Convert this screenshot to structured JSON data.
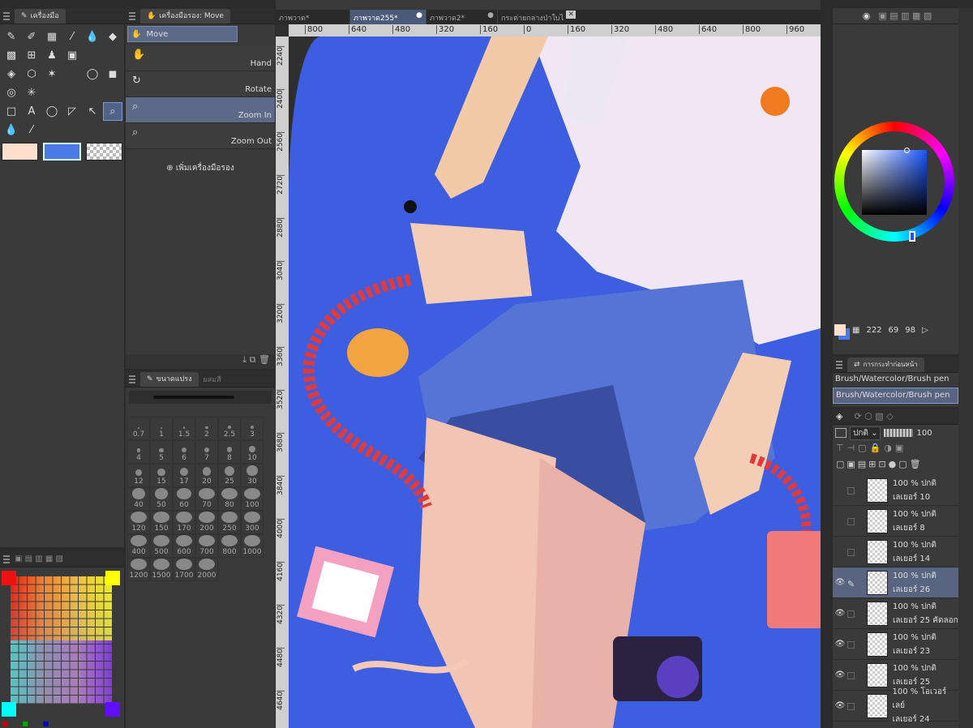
{
  "doc_tabs": [
    "ภาพวาด*",
    "ภาพวาด255*",
    "ภาพวาด2*",
    "กระต่ายกลางป่าใบไ"
  ],
  "tool_panel": {
    "title": "เครื่องมือ"
  },
  "subtool_panel": {
    "title": "เครื่องมือรอง: Move",
    "items": [
      {
        "label": "Move",
        "name": "move"
      },
      {
        "label": "Hand",
        "name": "hand"
      },
      {
        "label": "Rotate",
        "name": "rotate"
      },
      {
        "label": "Zoom In",
        "name": "zoom-in"
      },
      {
        "label": "Zoom Out",
        "name": "zoom-out"
      }
    ],
    "add_label": "เพิ่มเครื่องมือรอง"
  },
  "brush_size_panel": {
    "title": "ขนาดแปรง",
    "tab2": "ผสมสี",
    "sizes": [
      "0.7",
      "1",
      "1.5",
      "2",
      "2.5",
      "3",
      "4",
      "5",
      "6",
      "7",
      "8",
      "10",
      "12",
      "15",
      "17",
      "20",
      "25",
      "30",
      "40",
      "50",
      "60",
      "70",
      "80",
      "100",
      "120",
      "150",
      "170",
      "200",
      "250",
      "300",
      "400",
      "500",
      "600",
      "700",
      "800",
      "1000",
      "1200",
      "1500",
      "1700",
      "2000"
    ]
  },
  "ruler_top": [
    "800",
    "640",
    "480",
    "320",
    "160",
    "0",
    "160",
    "320",
    "480",
    "640",
    "800",
    "960"
  ],
  "ruler_left": [
    "2240",
    "2400",
    "2560",
    "2720",
    "2880",
    "3040",
    "3200",
    "3360",
    "3520",
    "3680",
    "3840",
    "4000",
    "4160",
    "4320",
    "4480",
    "4640"
  ],
  "color_values": {
    "h": "222",
    "s": "69",
    "v": "98"
  },
  "brush_history": {
    "title": "การกระทำก่อนหน้า",
    "items": [
      "Brush/Watercolor/Brush pen",
      "Brush/Watercolor/Brush pen"
    ]
  },
  "layer_panel": {
    "blend": "ปกติ",
    "opacity": "100",
    "layers": [
      {
        "pct": "100 % ปกติ",
        "name": "เลเยอร์ 10"
      },
      {
        "pct": "100 % ปกติ",
        "name": "เลเยอร์ 8"
      },
      {
        "pct": "100 % ปกติ",
        "name": "เลเยอร์ 14"
      },
      {
        "pct": "100 % ปกติ",
        "name": "เลเยอร์ 26"
      },
      {
        "pct": "100 % ปกติ",
        "name": "เลเยอร์ 25 คัดลอก"
      },
      {
        "pct": "100 % ปกติ",
        "name": "เลเยอร์ 23"
      },
      {
        "pct": "100 % ปกติ",
        "name": "เลเยอร์ 25"
      },
      {
        "pct": "100 % โอเวอร์เลย์",
        "name": "เลเยอร์ 24"
      }
    ]
  },
  "colors": {
    "main": "#ffe0cc",
    "sub": "#4a7ae8",
    "canvas_bg": "#3d5ee0",
    "accent": "#5b6a8c"
  }
}
